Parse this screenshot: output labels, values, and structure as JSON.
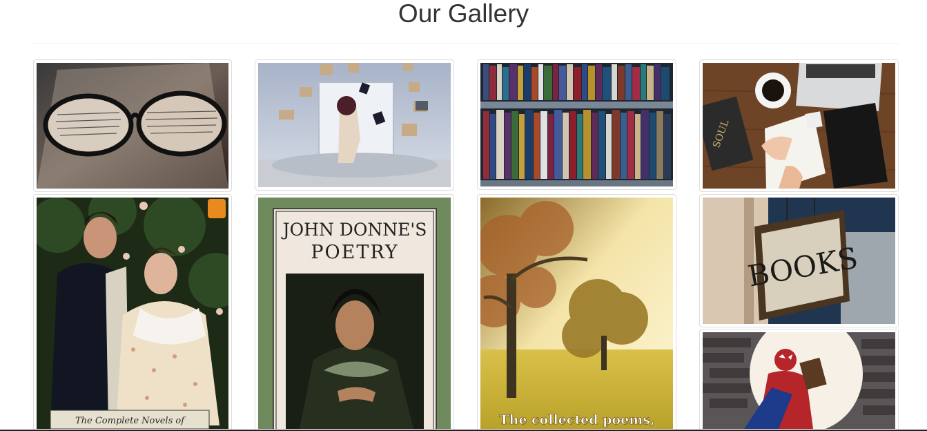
{
  "page": {
    "title": "Our Gallery"
  },
  "gallery": {
    "images": [
      {
        "name": "reading-glasses-photo"
      },
      {
        "name": "flying-books-photo"
      },
      {
        "name": "library-shelves-photo"
      },
      {
        "name": "desk-notebook-coffee-photo"
      },
      {
        "name": "pride-and-prejudice-cover",
        "caption": "The Complete Novels of"
      },
      {
        "name": "john-donne-poetry-cover",
        "cover_title_line1": "JOHN DONNE'S",
        "cover_title_line2": "POETRY"
      },
      {
        "name": "collected-poems-cover",
        "caption": "The collected poems,"
      },
      {
        "name": "books-sign-photo",
        "sign_text": "BOOKS"
      },
      {
        "name": "spiderman-reading-photo"
      }
    ]
  }
}
